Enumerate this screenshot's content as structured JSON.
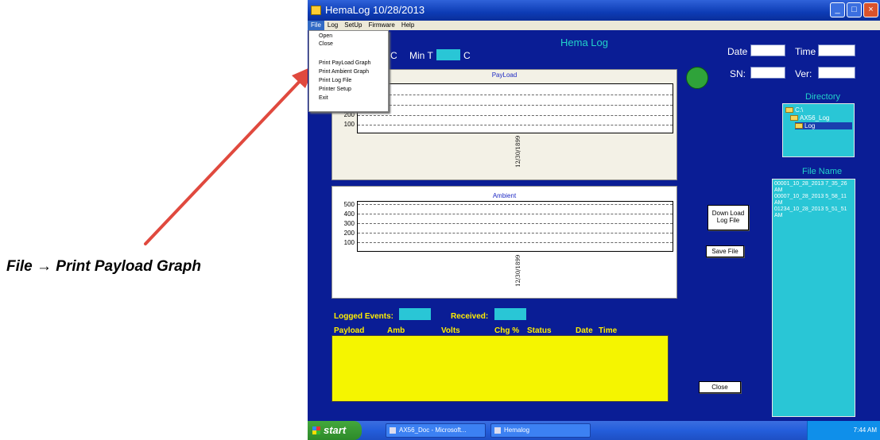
{
  "caption": "File → Print Payload Graph",
  "colors": {
    "window_bg": "#0a1d95",
    "accent_cyan": "#29c6d6",
    "title_cyan": "#22d3c9",
    "yellow_text": "#ffee00",
    "yellow_box": "#f5f500",
    "annotation_arrow": "#e0493e",
    "status_led": "#2fa33a"
  },
  "window": {
    "title": "HemaLog   10/28/2013",
    "app_title": "Hema Log"
  },
  "menubar": {
    "items": [
      "File",
      "Log",
      "SetUp",
      "Firmware",
      "Help"
    ]
  },
  "file_menu": {
    "items": [
      "Open",
      "Close",
      "Print PayLoad Graph",
      "Print Ambient Graph",
      "Print Log File",
      "Printer Setup",
      "Exit"
    ]
  },
  "header": {
    "max_t_unit": "C",
    "min_t_label": "Min T",
    "min_t_unit": "C",
    "date_label": "Date",
    "time_label": "Time",
    "sn_label": "SN:",
    "ver_label": "Ver:"
  },
  "payload_chart": {
    "title": "PayLoad",
    "y_ticks": [
      "200",
      "100"
    ],
    "x_date": "12/30/1899"
  },
  "ambient_chart": {
    "title": "Ambient",
    "y_ticks": [
      "500",
      "400",
      "300",
      "200",
      "100"
    ],
    "x_date": "12/30/1899"
  },
  "directory": {
    "title": "Directory",
    "items": [
      "C:\\",
      "AX56_Log",
      "Log"
    ]
  },
  "file_name": {
    "title": "File Name",
    "files": [
      "00001_10_28_2013 7_35_26 AM",
      "00007_10_28_2013 5_58_11 AM",
      "01234_10_28_2013 5_51_51 AM"
    ]
  },
  "buttons": {
    "download": "Down Load\nLog File",
    "save": "Save File",
    "close": "Close"
  },
  "events": {
    "logged_label": "Logged Events:",
    "received_label": "Received:",
    "columns": [
      "Payload",
      "Amb",
      "Volts",
      "Chg %",
      "Status",
      "Date",
      "Time"
    ]
  },
  "taskbar": {
    "start": "start",
    "tasks": [
      "AX56_Doc - Microsoft...",
      "Hemalog"
    ],
    "clock": "7:44 AM"
  }
}
